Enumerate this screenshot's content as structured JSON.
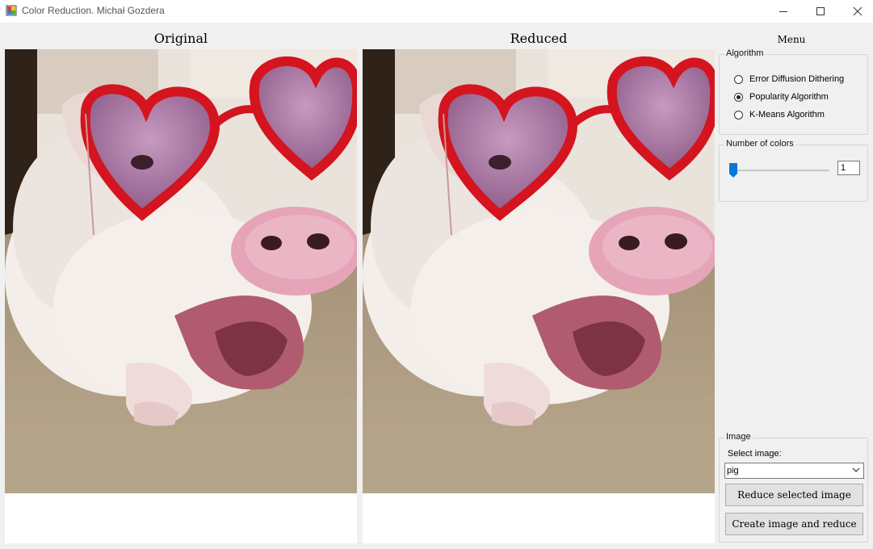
{
  "window": {
    "title": "Color Reduction. Michał Gozdera",
    "controls": [
      "minimize-icon",
      "maximize-icon",
      "close-icon"
    ]
  },
  "panels": {
    "original_title": "Original",
    "reduced_title": "Reduced"
  },
  "menu": {
    "title": "Menu",
    "algorithm": {
      "label": "Algorithm",
      "options": [
        {
          "label": "Error Diffusion Dithering",
          "checked": false
        },
        {
          "label": "Popularity Algorithm",
          "checked": true
        },
        {
          "label": "K-Means Algorithm",
          "checked": false
        }
      ]
    },
    "colors": {
      "label": "Number of colors",
      "value": "1"
    },
    "image": {
      "label": "Image",
      "select_label": "Select image:",
      "selected": "pig",
      "reduce_button": "Reduce selected image",
      "create_button": "Create image and reduce"
    }
  },
  "colors": {
    "accent": "#0078d7",
    "heart_glasses": "#d4141e",
    "button_bg": "#e1e1e1"
  }
}
